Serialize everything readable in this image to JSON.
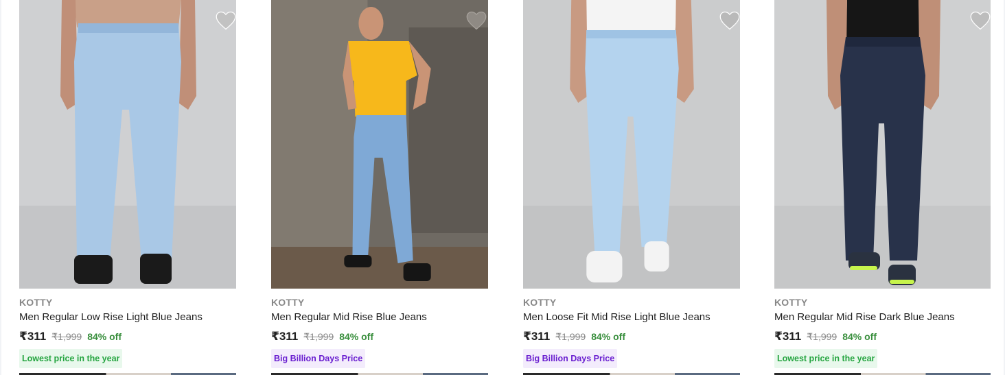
{
  "products": [
    {
      "brand": "KOTTY",
      "title": "Men Regular Low Rise Light Blue Jeans",
      "price": "₹311",
      "mrp": "₹1,999",
      "discount": "84% off",
      "badge": "Lowest price in the year",
      "badge_type": "lowest",
      "wishlist_icon": "heart-icon"
    },
    {
      "brand": "KOTTY",
      "title": "Men Regular Mid Rise Blue Jeans",
      "price": "₹311",
      "mrp": "₹1,999",
      "discount": "84% off",
      "badge": "Big Billion Days Price",
      "badge_type": "bbd",
      "wishlist_icon": "heart-icon"
    },
    {
      "brand": "KOTTY",
      "title": "Men Loose Fit Mid Rise Light Blue Jeans",
      "price": "₹311",
      "mrp": "₹1,999",
      "discount": "84% off",
      "badge": "Big Billion Days Price",
      "badge_type": "bbd",
      "wishlist_icon": "heart-icon"
    },
    {
      "brand": "KOTTY",
      "title": "Men Regular Mid Rise Dark Blue Jeans",
      "price": "₹311",
      "mrp": "₹1,999",
      "discount": "84% off",
      "badge": "Lowest price in the year",
      "badge_type": "lowest",
      "wishlist_icon": "heart-icon"
    }
  ],
  "colors": {
    "price_text": "#212121",
    "brand_text": "#878787",
    "discount_green": "#388e3c",
    "lowest_badge_bg": "#e8f8ec",
    "lowest_badge_text": "#26a541",
    "bbd_badge_bg": "#f3ecfc",
    "bbd_badge_text": "#6a1fd0",
    "wishlist_heart": "#c2c2c2"
  }
}
